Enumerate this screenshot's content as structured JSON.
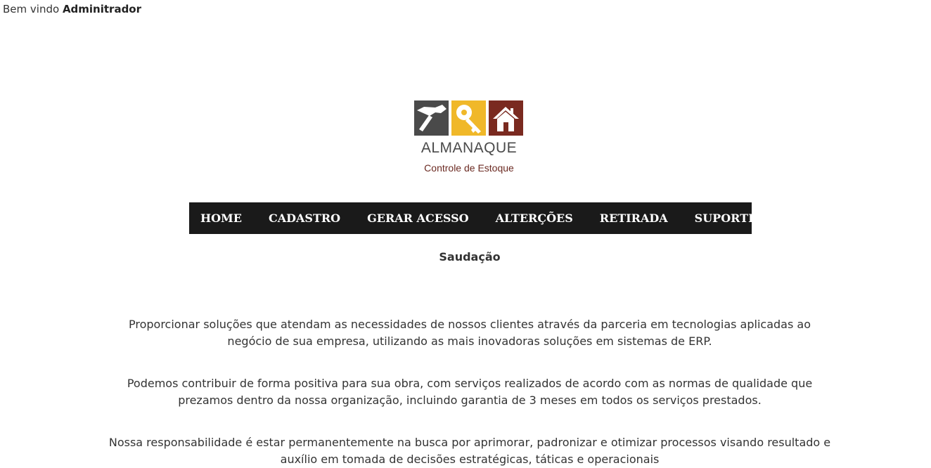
{
  "header": {
    "welcome_prefix": "Bem vindo",
    "user_name": "Adminitrador"
  },
  "logo": {
    "title": "ALMANAQUE",
    "subtitle": "Controle de Estoque",
    "tile_colors": [
      "#4a4a4a",
      "#f0b829",
      "#7a2a20"
    ],
    "tile_icons": [
      "hammer-icon",
      "key-icon",
      "house-icon"
    ]
  },
  "nav": {
    "items": [
      {
        "label": "HOME"
      },
      {
        "label": "CADASTRO"
      },
      {
        "label": "GERAR ACESSO"
      },
      {
        "label": "ALTERÇÕES"
      },
      {
        "label": "RETIRADA"
      },
      {
        "label": "SUPORTE"
      }
    ]
  },
  "main": {
    "title": "Saudação",
    "paragraphs": [
      "Proporcionar soluções que atendam as necessidades de nossos clientes através da parceria em tecnologias aplicadas ao negócio de sua empresa, utilizando as mais inovadoras soluções em sistemas de ERP.",
      "Podemos contribuir de forma positiva para sua obra, com serviços realizados de acordo com as normas de qualidade que prezamos dentro da nossa organização, incluindo garantia de 3 meses em todos os serviços prestados.",
      "Nossa responsabilidade é estar permanentemente na busca por aprimorar, padronizar e otimizar processos visando resultado e auxílio em tomada de decisões estratégicas, táticas e operacionais"
    ]
  }
}
